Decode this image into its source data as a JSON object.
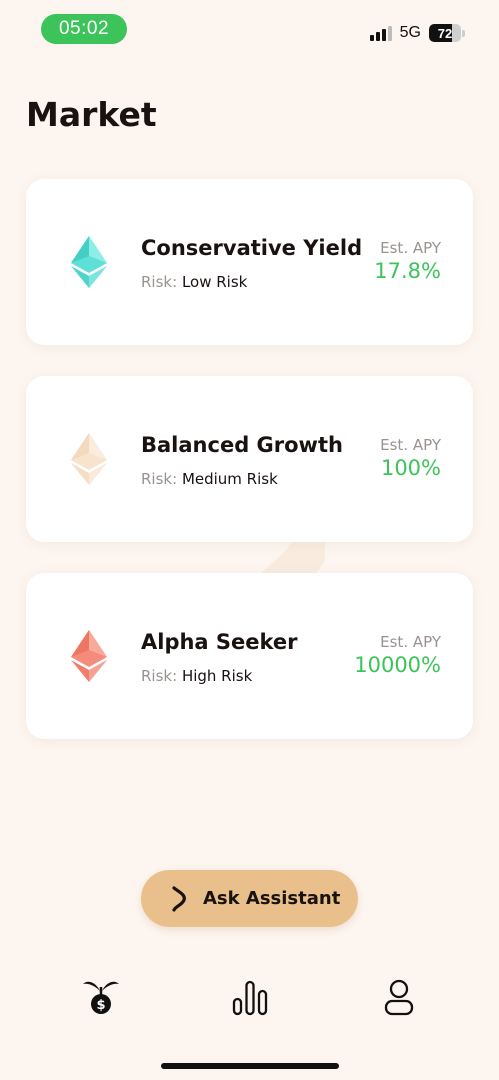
{
  "status_bar": {
    "time": "05:02",
    "network": "5G",
    "battery_level": "72",
    "battery_fraction": 0.72
  },
  "page": {
    "title": "Market"
  },
  "products": [
    {
      "name": "Conservative Yield",
      "risk_label": "Risk:",
      "risk_value": "Low Risk",
      "apy_label": "Est. APY",
      "apy_value": "17.8%",
      "icon": "ethereum-diamond-icon",
      "icon_color": "#5fe0d6"
    },
    {
      "name": "Balanced Growth",
      "risk_label": "Risk:",
      "risk_value": "Medium Risk",
      "apy_label": "Est. APY",
      "apy_value": "100%",
      "icon": "ethereum-diamond-icon",
      "icon_color": "#f8e3cc"
    },
    {
      "name": "Alpha Seeker",
      "risk_label": "Risk:",
      "risk_value": "High Risk",
      "apy_label": "Est. APY",
      "apy_value": "10000%",
      "icon": "ethereum-diamond-icon",
      "icon_color": "#f58b7a"
    }
  ],
  "assistant_button": {
    "label": "Ask Assistant",
    "icon": "assistant-logo-icon"
  },
  "tab_bar": {
    "tabs": [
      {
        "icon": "money-plant-icon",
        "active": true
      },
      {
        "icon": "bar-chart-icon",
        "active": false
      },
      {
        "icon": "user-profile-icon",
        "active": false
      }
    ]
  },
  "colors": {
    "background": "#fdf5ef",
    "accent_green": "#3cc45b",
    "button": "#e9c08b",
    "text_primary": "#1a1210",
    "text_muted": "#9a9290"
  }
}
